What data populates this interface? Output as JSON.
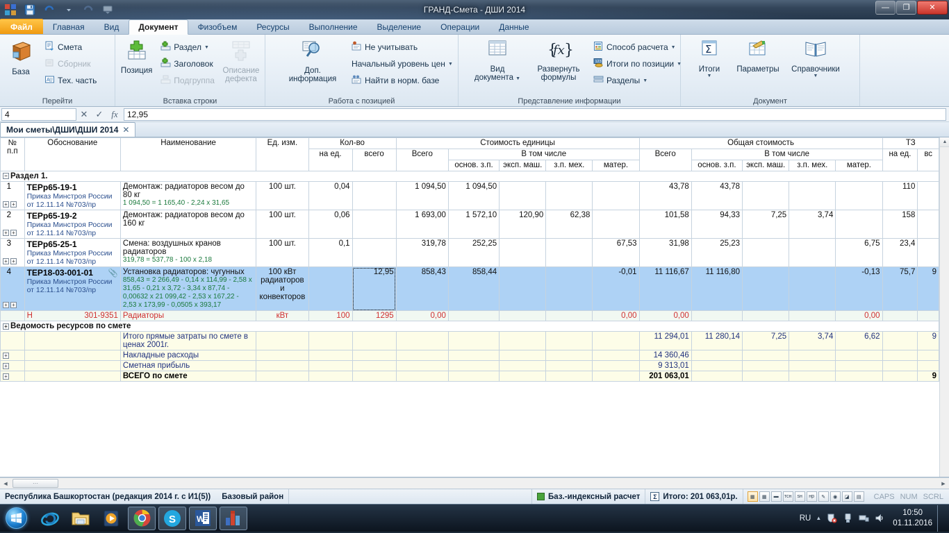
{
  "window": {
    "title": "ГРАНД-Смета - ДШИ 2014",
    "minimize": "—",
    "maximize": "❐",
    "close": "✕",
    "quick_access": [
      "app-icon",
      "save-icon",
      "undo-icon",
      "undo-dropdown",
      "redo-icon",
      "customize-icon"
    ]
  },
  "ribbon": {
    "tabs": [
      {
        "label": "Файл",
        "style": "file"
      },
      {
        "label": "Главная",
        "style": "normal"
      },
      {
        "label": "Вид",
        "style": "normal"
      },
      {
        "label": "Документ",
        "style": "active"
      },
      {
        "label": "Физобъем",
        "style": "normal"
      },
      {
        "label": "Ресурсы",
        "style": "normal"
      },
      {
        "label": "Выполнение",
        "style": "normal"
      },
      {
        "label": "Выделение",
        "style": "normal"
      },
      {
        "label": "Операции",
        "style": "normal"
      },
      {
        "label": "Данные",
        "style": "normal"
      }
    ],
    "groups": [
      {
        "name": "Перейти",
        "big": [
          {
            "label": "База",
            "icon": "database-icon"
          }
        ],
        "small": [
          {
            "label": "Смета",
            "icon": "estimate-icon",
            "disabled": false
          },
          {
            "label": "Сборник",
            "icon": "collection-icon",
            "disabled": true
          },
          {
            "label": "Тех. часть",
            "icon": "techpart-icon",
            "disabled": false
          }
        ]
      },
      {
        "name": "Вставка строки",
        "big": [
          {
            "label": "Позиция",
            "icon": "add-position-icon"
          }
        ],
        "small": [
          {
            "label": "Раздел",
            "icon": "add-section-icon",
            "disabled": false,
            "caret": true
          },
          {
            "label": "Заголовок",
            "icon": "add-header-icon",
            "disabled": false
          },
          {
            "label": "Подгруппа",
            "icon": "add-subgroup-icon",
            "disabled": true
          }
        ],
        "big2": [
          {
            "label": "Описание\nдефекта",
            "label1": "Описание",
            "label2": "дефекта",
            "icon": "defect-description-icon",
            "disabled": true
          }
        ]
      },
      {
        "name": "Работа с позицией",
        "big": [
          {
            "label1": "Доп.",
            "label2": "информация",
            "icon": "additional-info-icon"
          }
        ],
        "small": [
          {
            "label": "Не учитывать",
            "icon": "exclude-icon",
            "disabled": false
          },
          {
            "label": "Начальный уровень цен",
            "icon": "",
            "disabled": false,
            "caret": true
          },
          {
            "label": "Найти в норм. базе",
            "icon": "find-in-base-icon",
            "disabled": false
          }
        ]
      },
      {
        "name": "Представление информации",
        "big": [
          {
            "label1": "Вид",
            "label2": "документа",
            "icon": "document-view-icon",
            "caret": true
          },
          {
            "label1": "Развернуть",
            "label2": "формулы",
            "icon": "expand-formulas-icon"
          }
        ],
        "small": [
          {
            "label": "Способ расчета",
            "icon": "calc-method-icon",
            "disabled": false,
            "caret": true
          },
          {
            "label": "Итоги по позиции",
            "icon": "position-totals-icon",
            "disabled": false,
            "caret": true
          },
          {
            "label": "Разделы",
            "icon": "sections-icon",
            "disabled": false,
            "caret": true
          }
        ]
      },
      {
        "name": "Документ",
        "big": [
          {
            "label1": "Итоги",
            "label2": "",
            "icon": "totals-icon",
            "caret": true
          },
          {
            "label1": "Параметры",
            "label2": "",
            "icon": "parameters-icon"
          },
          {
            "label1": "Справочники",
            "label2": "",
            "icon": "handbooks-icon",
            "caret": true
          }
        ],
        "small": []
      }
    ]
  },
  "formula_bar": {
    "namebox_value": "4",
    "cancel_icon": "✕",
    "accept_icon": "✓",
    "fx_icon": "fx",
    "formula_value": "12,95"
  },
  "doc_tab": {
    "label": "Мои сметы\\ДШИ\\ДШИ 2014",
    "close": "✕"
  },
  "table": {
    "header_groups": [
      {
        "label": "№\nп.п",
        "l1": "№",
        "l2": "п.п"
      },
      {
        "label": "Обоснование"
      },
      {
        "label": "Наименование"
      },
      {
        "label": "Ед. изм."
      },
      {
        "label": "Кол-во",
        "sub": [
          "на ед.",
          "всего"
        ]
      },
      {
        "label": "Стоимость единицы",
        "sub_main": "Всего",
        "sub_group": "В том числе",
        "sub": [
          "основ. з.п.",
          "эксп. маш.",
          "з.п. мех.",
          "матер."
        ]
      },
      {
        "label": "Общая стоимость",
        "sub_main": "Всего",
        "sub_group": "В том числе",
        "sub": [
          "основ. з.п.",
          "эксп. маш.",
          "з.п. мех.",
          "матер."
        ]
      },
      {
        "label": "ТЗ",
        "sub": [
          "на ед.",
          "вс"
        ]
      }
    ],
    "section_row": {
      "expander": "−",
      "label": "Раздел 1."
    },
    "rows": [
      {
        "num": "1",
        "code": "ТЕРр65-19-1",
        "justification": "Приказ Минстроя России от 12.11.14 №703/пр",
        "name": "Демонтаж: радиаторов весом до 80 кг",
        "formula": "1 094,50 = 1 165,40 - 2,24 x 31,65",
        "unit": "100 шт.",
        "qty_per": "0,04",
        "qty_total": "",
        "unit_total": "1 094,50",
        "unit_zp": "1 094,50",
        "unit_mash": "",
        "unit_zpmeh": "",
        "unit_mat": "",
        "tot_total": "43,78",
        "tot_zp": "43,78",
        "tot_mash": "",
        "tot_zpmeh": "",
        "tot_mat": "",
        "tz_per": "110",
        "tz_all": "",
        "selected": false,
        "expanders": [
          "+",
          "+"
        ]
      },
      {
        "num": "2",
        "code": "ТЕРр65-19-2",
        "justification": "Приказ Минстроя России от 12.11.14 №703/пр",
        "name": "Демонтаж: радиаторов весом до 160 кг",
        "formula": "",
        "unit": "100 шт.",
        "qty_per": "0,06",
        "qty_total": "",
        "unit_total": "1 693,00",
        "unit_zp": "1 572,10",
        "unit_mash": "120,90",
        "unit_zpmeh": "62,38",
        "unit_mat": "",
        "tot_total": "101,58",
        "tot_zp": "94,33",
        "tot_mash": "7,25",
        "tot_zpmeh": "3,74",
        "tot_mat": "",
        "tz_per": "158",
        "tz_all": "",
        "selected": false,
        "expanders": [
          "+",
          "+"
        ]
      },
      {
        "num": "3",
        "code": "ТЕРр65-25-1",
        "justification": "Приказ Минстроя России от 12.11.14 №703/пр",
        "name": "Смена: воздушных кранов радиаторов",
        "formula": "319,78 = 537,78 - 100 x 2,18",
        "unit": "100 шт.",
        "qty_per": "0,1",
        "qty_total": "",
        "unit_total": "319,78",
        "unit_zp": "252,25",
        "unit_mash": "",
        "unit_zpmeh": "",
        "unit_mat": "67,53",
        "tot_total": "31,98",
        "tot_zp": "25,23",
        "tot_mash": "",
        "tot_zpmeh": "",
        "tot_mat": "6,75",
        "tz_per": "23,4",
        "tz_all": "",
        "selected": false,
        "expanders": [
          "+",
          "+"
        ]
      },
      {
        "num": "4",
        "code": "ТЕР18-03-001-01",
        "attachment": "📎",
        "justification": "Приказ Минстроя России от 12.11.14 №703/пр",
        "name": "Установка радиаторов: чугунных",
        "formula": "858,43 = 2 266,49 - 0,14 x 114,99 - 2,58 x 31,65 - 0,21 x 3,72 - 3,34 x 87,74 - 0,00632 x 21 099,42 - 2,53 x 167,22 - 2,53 x 173,99 - 0,0505 x 393,17",
        "unit": "100 кВт радиаторов и конвекторов",
        "qty_per": "",
        "qty_total": "12,95",
        "unit_total": "858,43",
        "unit_zp": "858,44",
        "unit_mash": "",
        "unit_zpmeh": "",
        "unit_mat": "-0,01",
        "tot_total": "11 116,67",
        "tot_zp": "11 116,80",
        "tot_mash": "",
        "tot_zpmeh": "",
        "tot_mat": "-0,13",
        "tz_per": "75,7",
        "tz_all": "9",
        "selected": true,
        "expanders": [
          "+",
          "+"
        ]
      }
    ],
    "resource_row": {
      "marker": "Н",
      "code": "301-9351",
      "name": "Радиаторы",
      "unit": "кВт",
      "qty_per": "100",
      "qty_total": "1295",
      "unit_total": "0,00",
      "unit_zp": "",
      "unit_mash": "",
      "unit_zpmeh": "",
      "unit_mat": "0,00",
      "tot_total": "0,00",
      "tot_zp": "",
      "tot_mash": "",
      "tot_zpmeh": "",
      "tot_mat": "0,00",
      "tz_per": "",
      "tz_all": ""
    },
    "resources_section": {
      "expander": "+",
      "label": "Ведомость ресурсов по смете"
    },
    "totals": [
      {
        "expander": "",
        "label": "Итого прямые затраты по смете в ценах 2001г.",
        "total": "11 294,01",
        "zp": "11 280,14",
        "mash": "7,25",
        "zpmeh": "3,74",
        "mat": "6,62",
        "tz_per": "",
        "tz_all": "9",
        "bold": false
      },
      {
        "expander": "+",
        "label": "Накладные расходы",
        "total": "14 360,46",
        "zp": "",
        "mash": "",
        "zpmeh": "",
        "mat": "",
        "tz_per": "",
        "tz_all": "",
        "bold": false
      },
      {
        "expander": "+",
        "label": "Сметная прибыль",
        "total": "9 313,01",
        "zp": "",
        "mash": "",
        "zpmeh": "",
        "mat": "",
        "tz_per": "",
        "tz_all": "",
        "bold": false
      },
      {
        "expander": "+",
        "label": "ВСЕГО по смете",
        "total": "201 063,01",
        "zp": "",
        "mash": "",
        "zpmeh": "",
        "mat": "",
        "tz_per": "",
        "tz_all": "9",
        "bold": true
      }
    ]
  },
  "statusbar": {
    "region": "Республика Башкортостан (редакция 2014 г. с И1(5))",
    "district": "Базовый район",
    "calc_mode": "Баз.-индексный расчет",
    "sum_icon": "Σ",
    "total": "Итого: 201 063,01р.",
    "indicator_icons": [
      "grid-yellow-icon",
      "grid-blue-icon",
      "flag-icon",
      "tsn-icon",
      "sn-icon",
      "hp-icon",
      "pencil-icon",
      "coins-icon",
      "chart-icon",
      "ruler-icon"
    ],
    "keys": [
      "CAPS",
      "NUM",
      "SCRL"
    ]
  },
  "taskbar": {
    "start": "start-orb",
    "items": [
      {
        "name": "internet-explorer-icon"
      },
      {
        "name": "explorer-icon"
      },
      {
        "name": "media-player-icon"
      },
      {
        "name": "chrome-icon",
        "running": true
      },
      {
        "name": "skype-icon",
        "running": true
      },
      {
        "name": "word-icon",
        "running": true
      },
      {
        "name": "grand-smeta-icon",
        "running": true
      }
    ],
    "tray": {
      "language": "RU",
      "show_hidden": "▲",
      "icons": [
        "security-icon",
        "usb-icon",
        "network-icon",
        "volume-icon"
      ],
      "time": "10:50",
      "date": "01.11.2016"
    }
  }
}
